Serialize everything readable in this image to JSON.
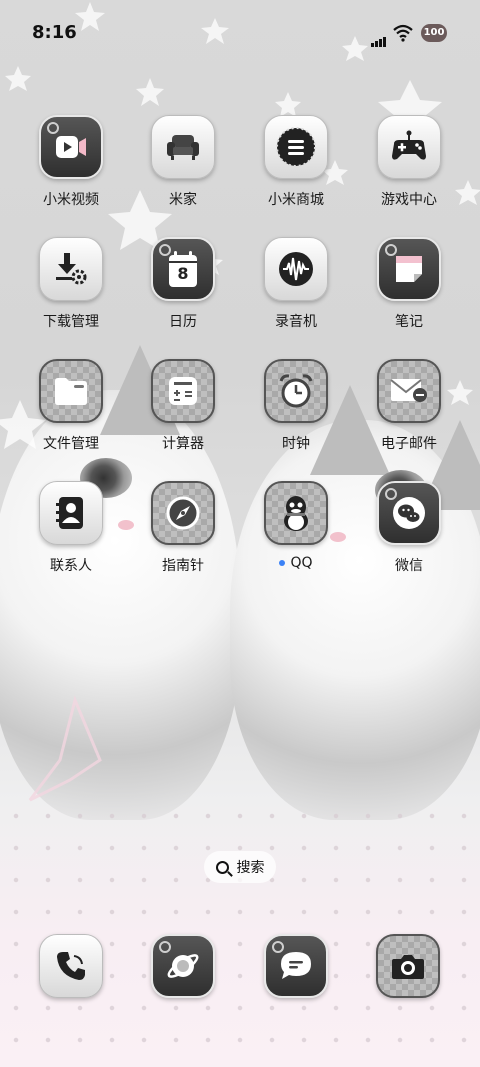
{
  "status_bar": {
    "time": "8:16",
    "battery": "100"
  },
  "apps": [
    {
      "label": "小米视频",
      "icon": "video-play-icon"
    },
    {
      "label": "米家",
      "icon": "sofa-icon"
    },
    {
      "label": "小米商城",
      "icon": "store-menu-icon"
    },
    {
      "label": "游戏中心",
      "icon": "gamepad-icon"
    },
    {
      "label": "下载管理",
      "icon": "download-gear-icon"
    },
    {
      "label": "日历",
      "icon": "calendar-icon",
      "date": "8"
    },
    {
      "label": "录音机",
      "icon": "waveform-icon"
    },
    {
      "label": "笔记",
      "icon": "note-icon"
    },
    {
      "label": "文件管理",
      "icon": "folder-icon"
    },
    {
      "label": "计算器",
      "icon": "calculator-icon"
    },
    {
      "label": "时钟",
      "icon": "alarm-clock-icon"
    },
    {
      "label": "电子邮件",
      "icon": "mail-icon"
    },
    {
      "label": "联系人",
      "icon": "contacts-icon"
    },
    {
      "label": "指南针",
      "icon": "compass-icon"
    },
    {
      "label": "QQ",
      "icon": "penguin-icon",
      "has_update_dot": true
    },
    {
      "label": "微信",
      "icon": "wechat-icon"
    }
  ],
  "search": {
    "label": "搜索"
  },
  "dock": [
    {
      "icon": "phone-icon"
    },
    {
      "icon": "browser-planet-icon"
    },
    {
      "icon": "message-icon"
    },
    {
      "icon": "camera-icon"
    }
  ],
  "colors": {
    "update_dot": "#3b82f6",
    "icon_dark": "#3a3a3a"
  }
}
